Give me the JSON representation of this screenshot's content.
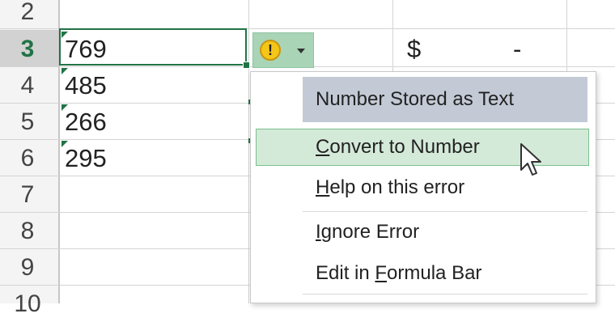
{
  "rows": [
    {
      "num": "2",
      "value": ""
    },
    {
      "num": "3",
      "value": "769"
    },
    {
      "num": "4",
      "value": "485"
    },
    {
      "num": "5",
      "value": "266"
    },
    {
      "num": "6",
      "value": "295"
    },
    {
      "num": "7",
      "value": ""
    },
    {
      "num": "8",
      "value": ""
    },
    {
      "num": "9",
      "value": ""
    },
    {
      "num": "10",
      "value": ""
    }
  ],
  "active_row": "3",
  "currency_cell": {
    "symbol": "$",
    "value": "-"
  },
  "error_button": {
    "icon": "warning-icon",
    "glyph": "!",
    "dropdown_icon": "chevron-down-icon"
  },
  "menu": {
    "header": "Number Stored as Text",
    "items": [
      {
        "pre": "",
        "accel": "C",
        "post": "onvert to Number"
      },
      {
        "pre": "",
        "accel": "H",
        "post": "elp on this error"
      },
      {
        "pre": "",
        "accel": "I",
        "post": "gnore Error"
      },
      {
        "pre": "Edit in ",
        "accel": "F",
        "post": "ormula Bar"
      }
    ]
  },
  "colors": {
    "accent": "#217346",
    "menu_header": "#c3cad6",
    "hover": "#d4ead9"
  }
}
